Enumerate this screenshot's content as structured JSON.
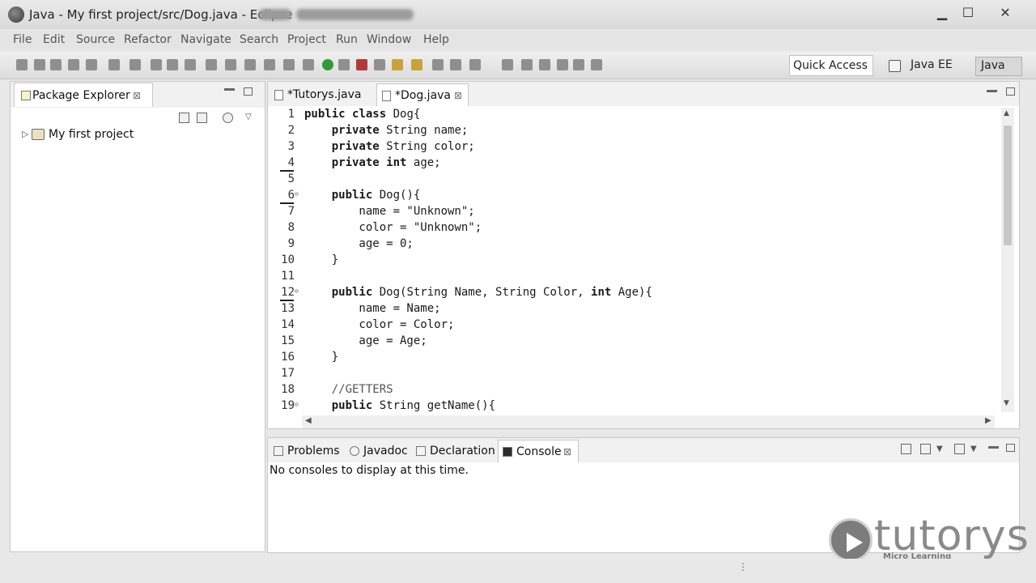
{
  "window": {
    "title": "Java - My first project/src/Dog.java - Eclipse",
    "minimize_glyph": "▁",
    "maximize_glyph": "☐",
    "close_glyph": "✕"
  },
  "menu": [
    "File",
    "Edit",
    "Source",
    "Refactor",
    "Navigate",
    "Search",
    "Project",
    "Run",
    "Window",
    "Help"
  ],
  "toolbar": {
    "quick_access": "Quick Access",
    "perspectives": [
      "Java EE",
      "Java"
    ]
  },
  "package_explorer": {
    "tab_label": "Package Explorer",
    "close_glyph": "⊠",
    "project": "My first project",
    "expand_glyph": "▷"
  },
  "editor": {
    "tabs": [
      {
        "label": "*Tutorys.java",
        "active": false
      },
      {
        "label": "*Dog.java",
        "active": true,
        "close_glyph": "⊠"
      }
    ],
    "lines": [
      {
        "n": "1",
        "text": "public class Dog{"
      },
      {
        "n": "2",
        "text": "    private String name;"
      },
      {
        "n": "3",
        "text": "    private String color;"
      },
      {
        "n": "4",
        "text": "    private int age;"
      },
      {
        "n": "5",
        "text": ""
      },
      {
        "n": "6",
        "text": "    public Dog(){",
        "fold": true
      },
      {
        "n": "7",
        "text": "        name = \"Unknown\";"
      },
      {
        "n": "8",
        "text": "        color = \"Unknown\";"
      },
      {
        "n": "9",
        "text": "        age = 0;"
      },
      {
        "n": "10",
        "text": "    }"
      },
      {
        "n": "11",
        "text": ""
      },
      {
        "n": "12",
        "text": "    public Dog(String Name, String Color, int Age){",
        "fold": true
      },
      {
        "n": "13",
        "text": "        name = Name;"
      },
      {
        "n": "14",
        "text": "        color = Color;"
      },
      {
        "n": "15",
        "text": "        age = Age;"
      },
      {
        "n": "16",
        "text": "    }"
      },
      {
        "n": "17",
        "text": ""
      },
      {
        "n": "18",
        "text": "    //GETTERS"
      },
      {
        "n": "19",
        "text": "    public String getName(){",
        "fold": true
      }
    ]
  },
  "bottom_panel": {
    "tabs": [
      {
        "label": "Problems",
        "active": false
      },
      {
        "label": "Javadoc",
        "active": false
      },
      {
        "label": "Declaration",
        "active": false
      },
      {
        "label": "Console",
        "active": true,
        "close_glyph": "⊠"
      }
    ],
    "console_message": "No consoles to display at this time."
  },
  "watermark": {
    "brand": "tutorys",
    "tagline": "Micro Learning"
  }
}
